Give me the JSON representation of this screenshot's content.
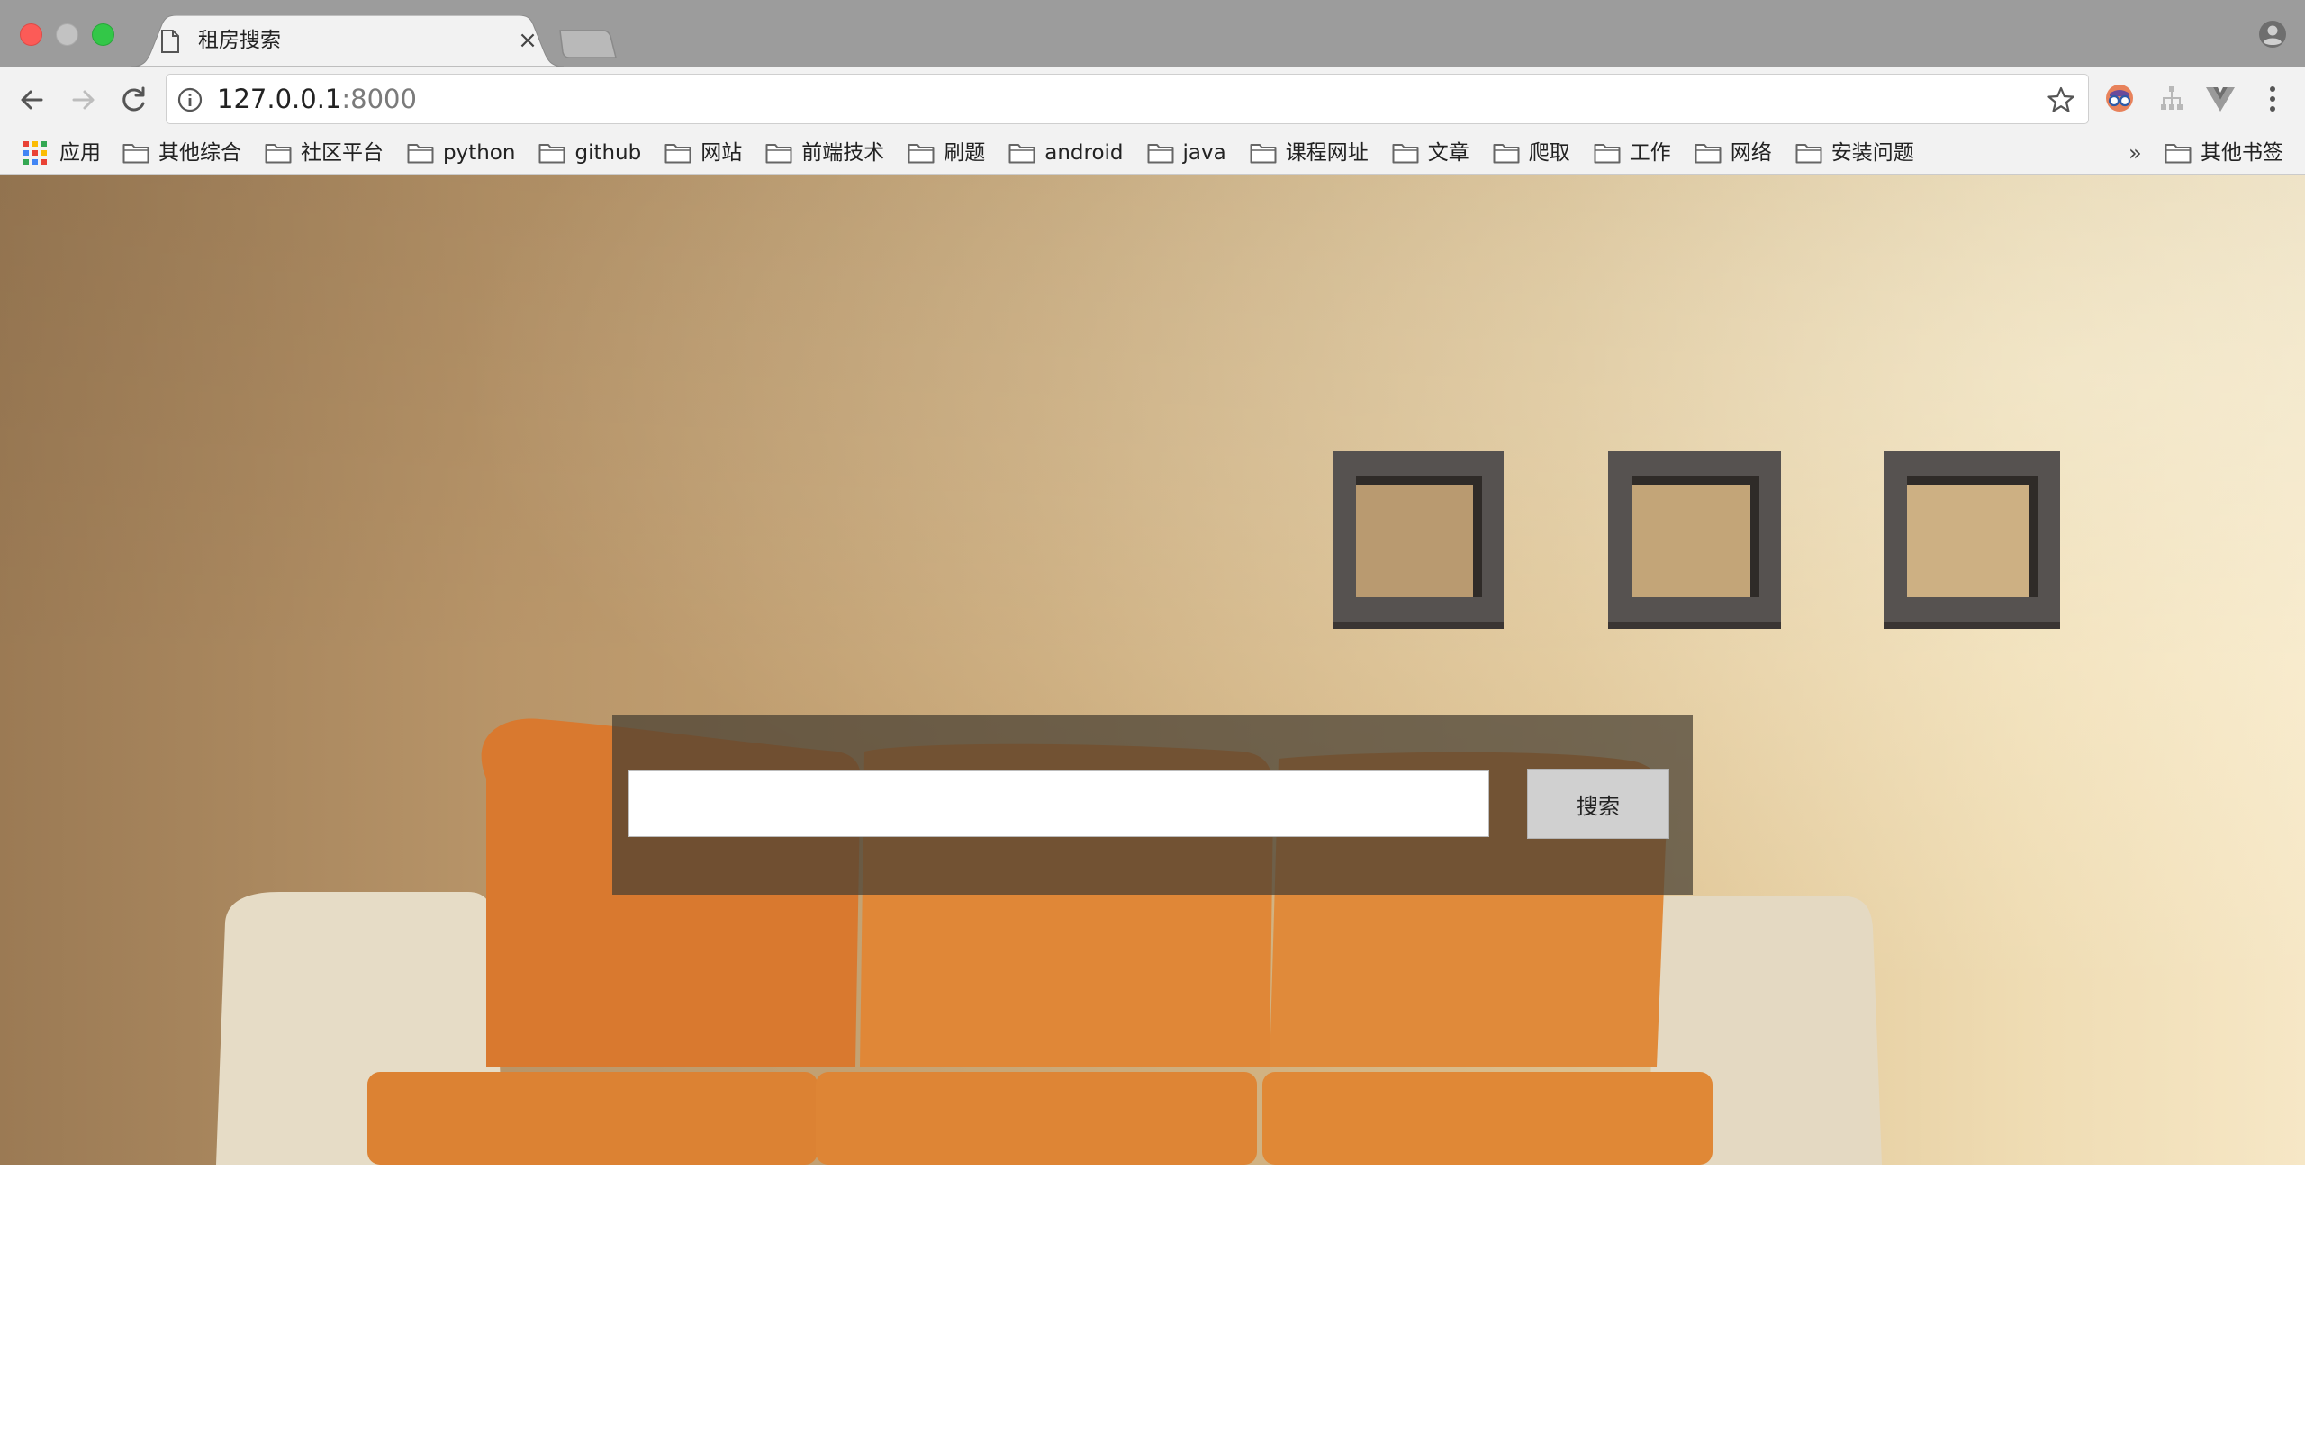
{
  "tab": {
    "title": "租房搜索",
    "close_glyph": "×"
  },
  "address_bar": {
    "host": "127.0.0.1",
    "port": ":8000"
  },
  "bookmarks": {
    "apps_label": "应用",
    "items": [
      "其他综合",
      "社区平台",
      "python",
      "github",
      "网站",
      "前端技术",
      "刷题",
      "android",
      "java",
      "课程网址",
      "文章",
      "爬取",
      "工作",
      "网络",
      "安装问题"
    ],
    "overflow_glyph": "»",
    "other_label": "其他书签"
  },
  "search": {
    "input_value": "",
    "button_label": "搜索"
  },
  "colors": {
    "tab_strip": "#9c9c9c",
    "toolbar": "#f2f2f2",
    "search_panel": "#463e32",
    "search_button": "#d0d0d0"
  },
  "icons": {
    "close_window": "red-traffic-light",
    "minimize_window": "gray-traffic-light",
    "maximize_window": "green-traffic-light",
    "tab_page": "page-icon",
    "back": "arrow-left-icon",
    "forward": "arrow-right-icon",
    "reload": "reload-icon",
    "site_info": "info-icon",
    "bookmark_star": "star-icon",
    "menu": "kebab-menu-icon",
    "profile": "profile-icon",
    "folder": "folder-icon"
  }
}
